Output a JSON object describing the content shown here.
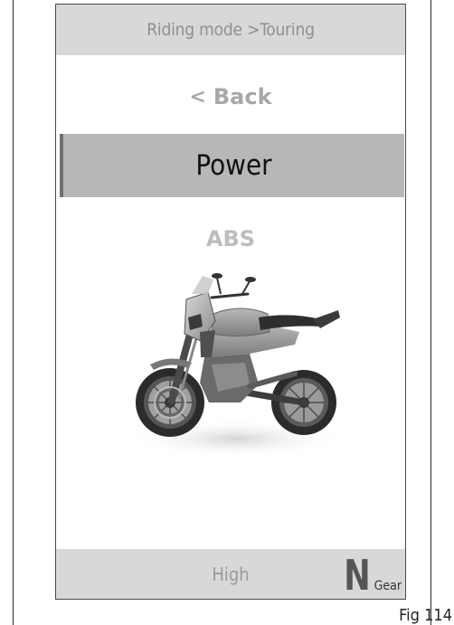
{
  "header": {
    "breadcrumb": "Riding mode >Touring"
  },
  "menu": {
    "back_chevron": "<",
    "back_label": "Back",
    "selected_label": "Power",
    "next_label": "ABS"
  },
  "image": {
    "icon": "motorcycle-icon"
  },
  "footer": {
    "value": "High",
    "gear_value": "N",
    "gear_label": "Gear"
  },
  "figure": {
    "label": "Fig 114"
  }
}
